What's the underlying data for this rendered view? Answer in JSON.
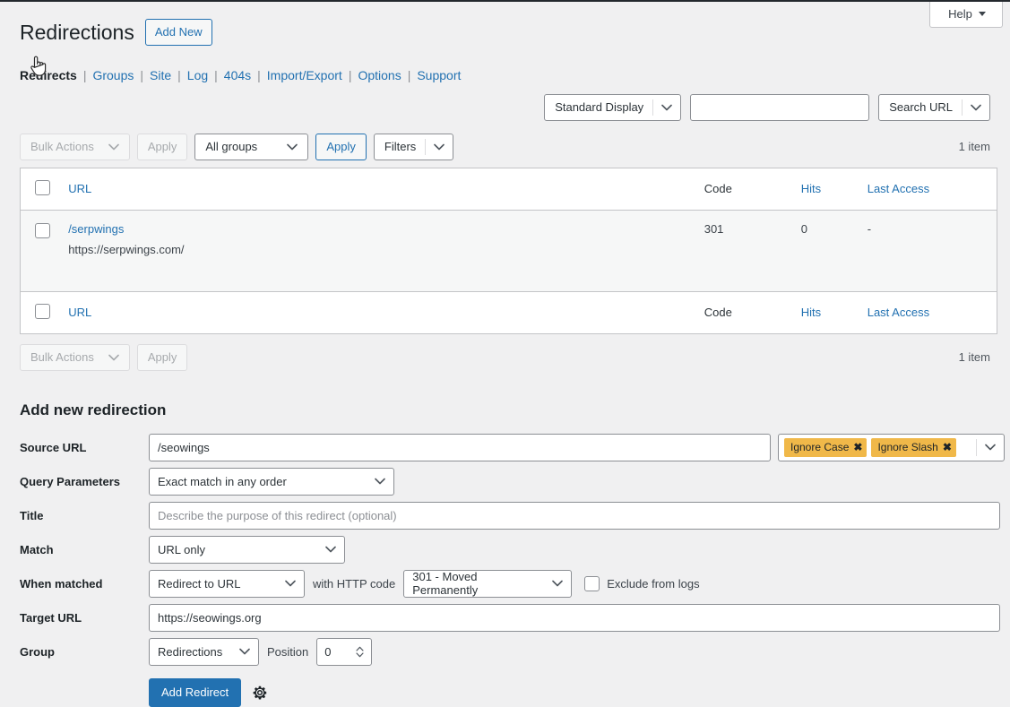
{
  "top": {
    "help_label": "Help"
  },
  "header": {
    "title": "Redirections",
    "add_new_label": "Add New"
  },
  "subnav": {
    "items": [
      {
        "label": "Redirects",
        "current": true
      },
      {
        "label": "Groups",
        "current": false
      },
      {
        "label": "Site",
        "current": false
      },
      {
        "label": "Log",
        "current": false
      },
      {
        "label": "404s",
        "current": false
      },
      {
        "label": "Import/Export",
        "current": false
      },
      {
        "label": "Options",
        "current": false
      },
      {
        "label": "Support",
        "current": false
      }
    ],
    "separator": "|"
  },
  "display_controls": {
    "display_mode_label": "Standard Display",
    "search_value": "",
    "search_placeholder": "",
    "search_scope_label": "Search URL"
  },
  "tablenav_top": {
    "bulk_actions_label": "Bulk Actions",
    "apply_label": "Apply",
    "group_filter_label": "All groups",
    "apply_group_label": "Apply",
    "filters_label": "Filters",
    "item_count": "1 item"
  },
  "table": {
    "columns": {
      "url": "URL",
      "code": "Code",
      "hits": "Hits",
      "last_access": "Last Access"
    },
    "rows": [
      {
        "source": "/serpwings",
        "target": "https://serpwings.com/",
        "code": "301",
        "hits": "0",
        "last_access": "-"
      }
    ]
  },
  "tablenav_bottom": {
    "bulk_actions_label": "Bulk Actions",
    "apply_label": "Apply",
    "item_count": "1 item"
  },
  "form": {
    "title": "Add new redirection",
    "labels": {
      "source_url": "Source URL",
      "query_parameters": "Query Parameters",
      "title": "Title",
      "match": "Match",
      "when_matched": "When matched",
      "target_url": "Target URL",
      "group": "Group",
      "position": "Position",
      "with_http_code": "with HTTP code",
      "exclude_from_logs": "Exclude from logs"
    },
    "values": {
      "source_url": "/seowings",
      "query_parameters": "Exact match in any order",
      "title": "",
      "title_placeholder": "Describe the purpose of this redirect (optional)",
      "match": "URL only",
      "when_matched": "Redirect to URL",
      "http_code": "301 - Moved Permanently",
      "target_url": "https://seowings.org",
      "group": "Redirections",
      "position": "0"
    },
    "flags": [
      {
        "label": "Ignore Case",
        "remove": "✖"
      },
      {
        "label": "Ignore Slash",
        "remove": "✖"
      }
    ],
    "submit_label": "Add Redirect"
  },
  "colors": {
    "accent_blue": "#2271b1",
    "flag_yellow": "#f0b849",
    "page_bg": "#f0f0f1",
    "row_bg": "#f6f7f7",
    "border": "#c3c4c7",
    "text_dark": "#1d2327"
  }
}
